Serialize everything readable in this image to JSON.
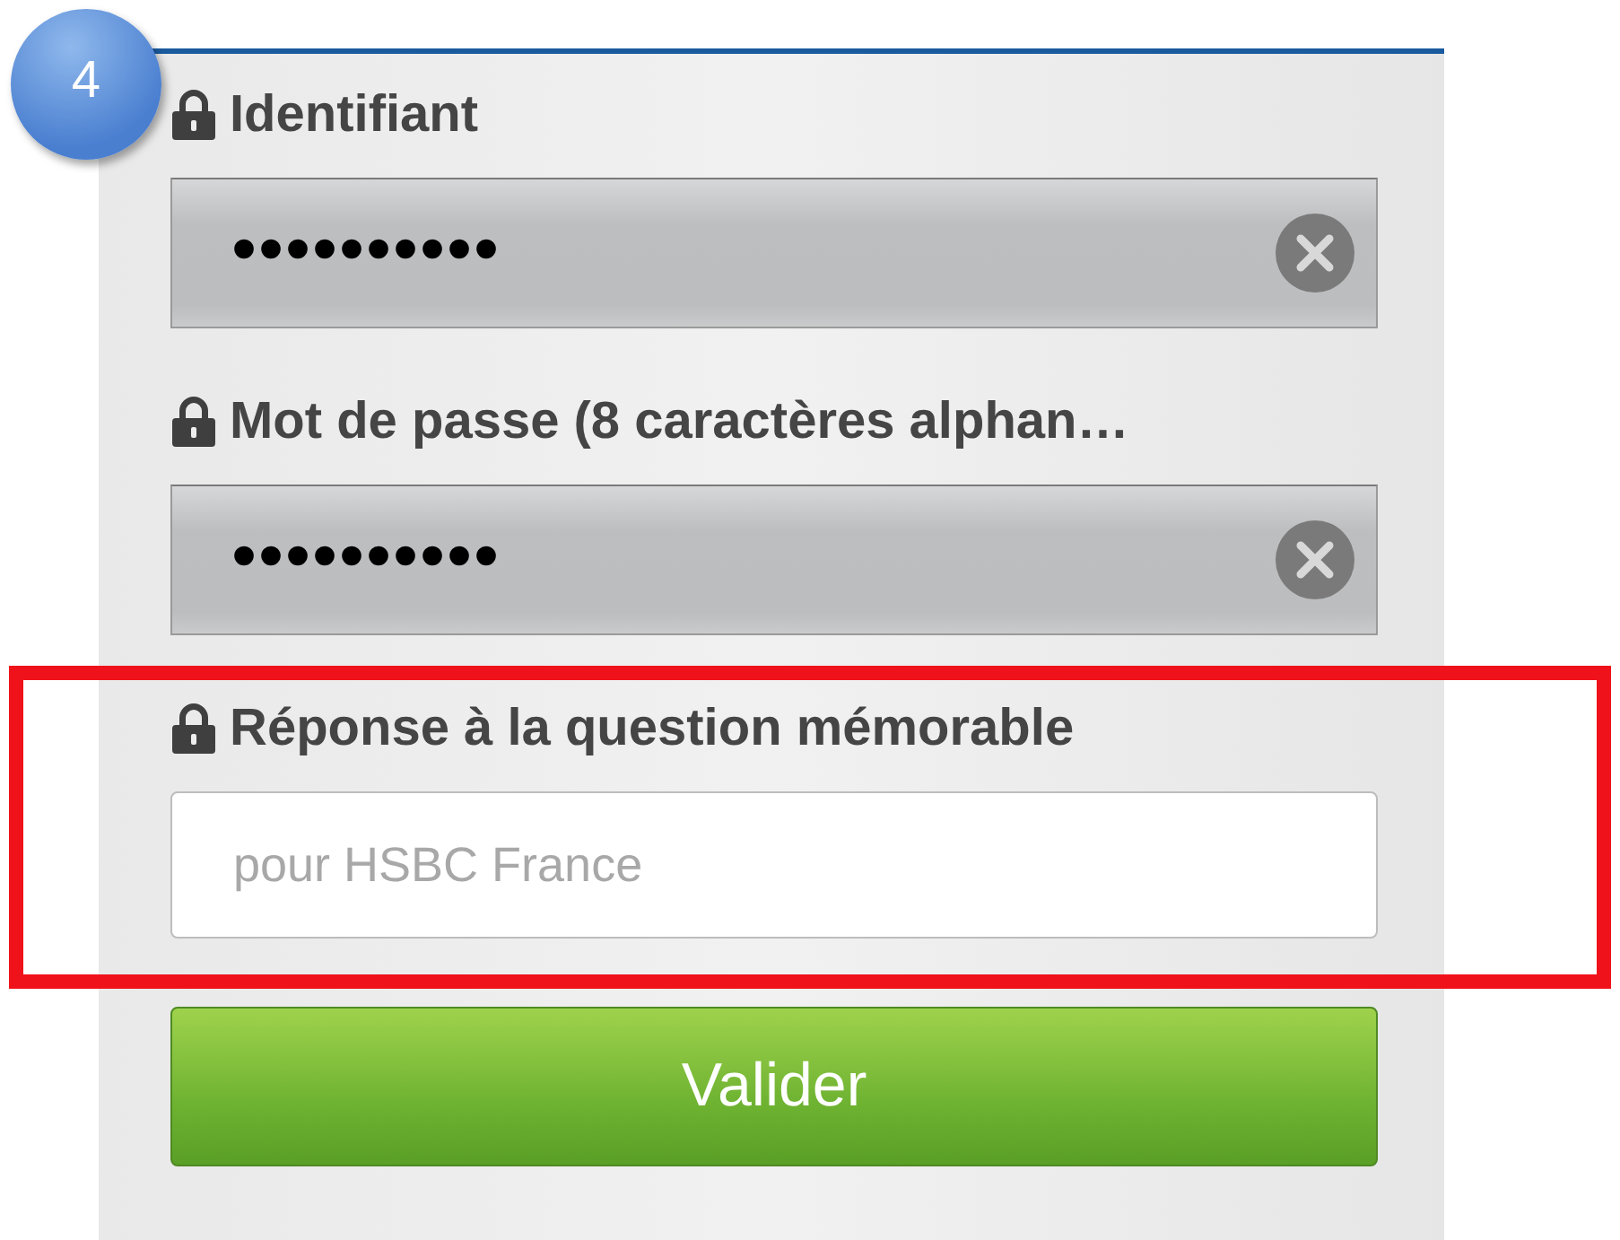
{
  "step_badge": {
    "label": "4"
  },
  "fields": [
    {
      "kind": "password",
      "label": "Identifiant",
      "value": "••••••••••",
      "highlighted": false
    },
    {
      "kind": "password",
      "label": "Mot de passe (8 caractères alphan…",
      "value": "••••••••••",
      "highlighted": false
    },
    {
      "kind": "text",
      "label": "Réponse à la question mémorable",
      "placeholder": "pour HSBC France",
      "highlighted": true
    }
  ],
  "submit_button": {
    "label": "Valider"
  }
}
